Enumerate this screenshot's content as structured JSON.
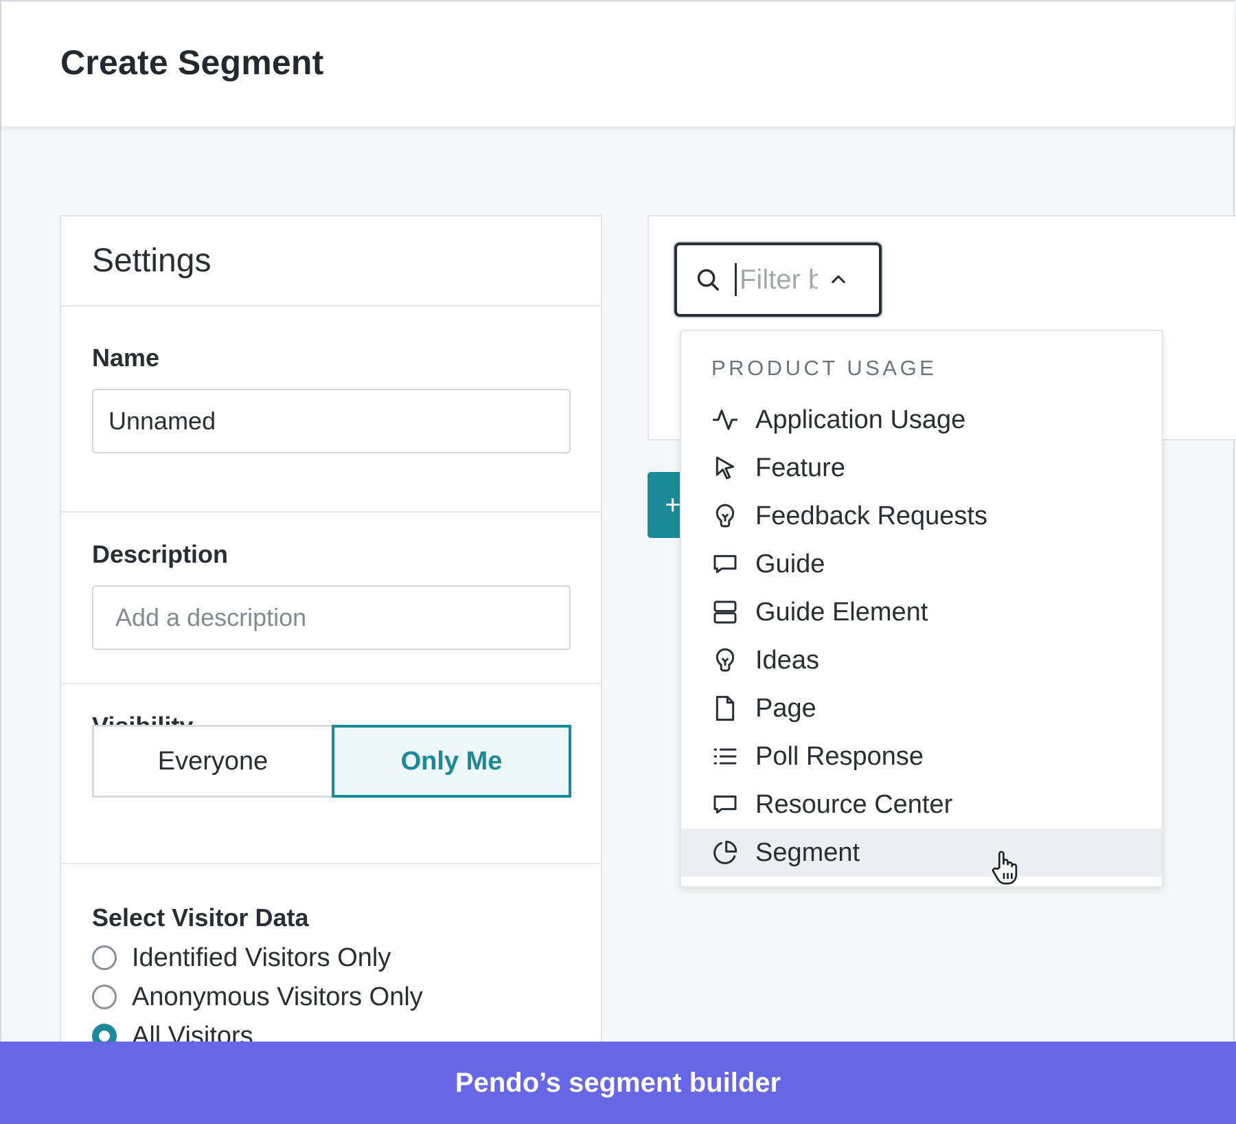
{
  "header": {
    "title": "Create Segment"
  },
  "settings": {
    "title": "Settings",
    "name": {
      "label": "Name",
      "value": "Unnamed"
    },
    "description": {
      "label": "Description",
      "placeholder": "Add a description"
    },
    "visibility": {
      "label": "Visibility",
      "options": [
        "Everyone",
        "Only Me"
      ],
      "selected": "Only Me"
    },
    "visitor_data": {
      "label": "Select Visitor Data",
      "options": [
        "Identified Visitors Only",
        "Anonymous Visitors Only",
        "All Visitors"
      ],
      "selected": "All Visitors"
    }
  },
  "filter": {
    "placeholder": "Filter by"
  },
  "add_button": {
    "label": "+"
  },
  "dropdown": {
    "group": "PRODUCT USAGE",
    "items": [
      {
        "label": "Application Usage",
        "icon": "activity-icon"
      },
      {
        "label": "Feature",
        "icon": "pointer-icon"
      },
      {
        "label": "Feedback Requests",
        "icon": "lightbulb-icon"
      },
      {
        "label": "Guide",
        "icon": "message-icon"
      },
      {
        "label": "Guide Element",
        "icon": "stack-icon"
      },
      {
        "label": "Ideas",
        "icon": "lightbulb-icon"
      },
      {
        "label": "Page",
        "icon": "file-icon"
      },
      {
        "label": "Poll Response",
        "icon": "list-icon"
      },
      {
        "label": "Resource Center",
        "icon": "message-icon"
      },
      {
        "label": "Segment",
        "icon": "pie-chart-icon"
      }
    ],
    "hovered": "Segment"
  },
  "caption": {
    "text": "Pendo’s segment builder"
  },
  "colors": {
    "accent": "#1a8a99",
    "caption_bg": "#6666e6"
  }
}
